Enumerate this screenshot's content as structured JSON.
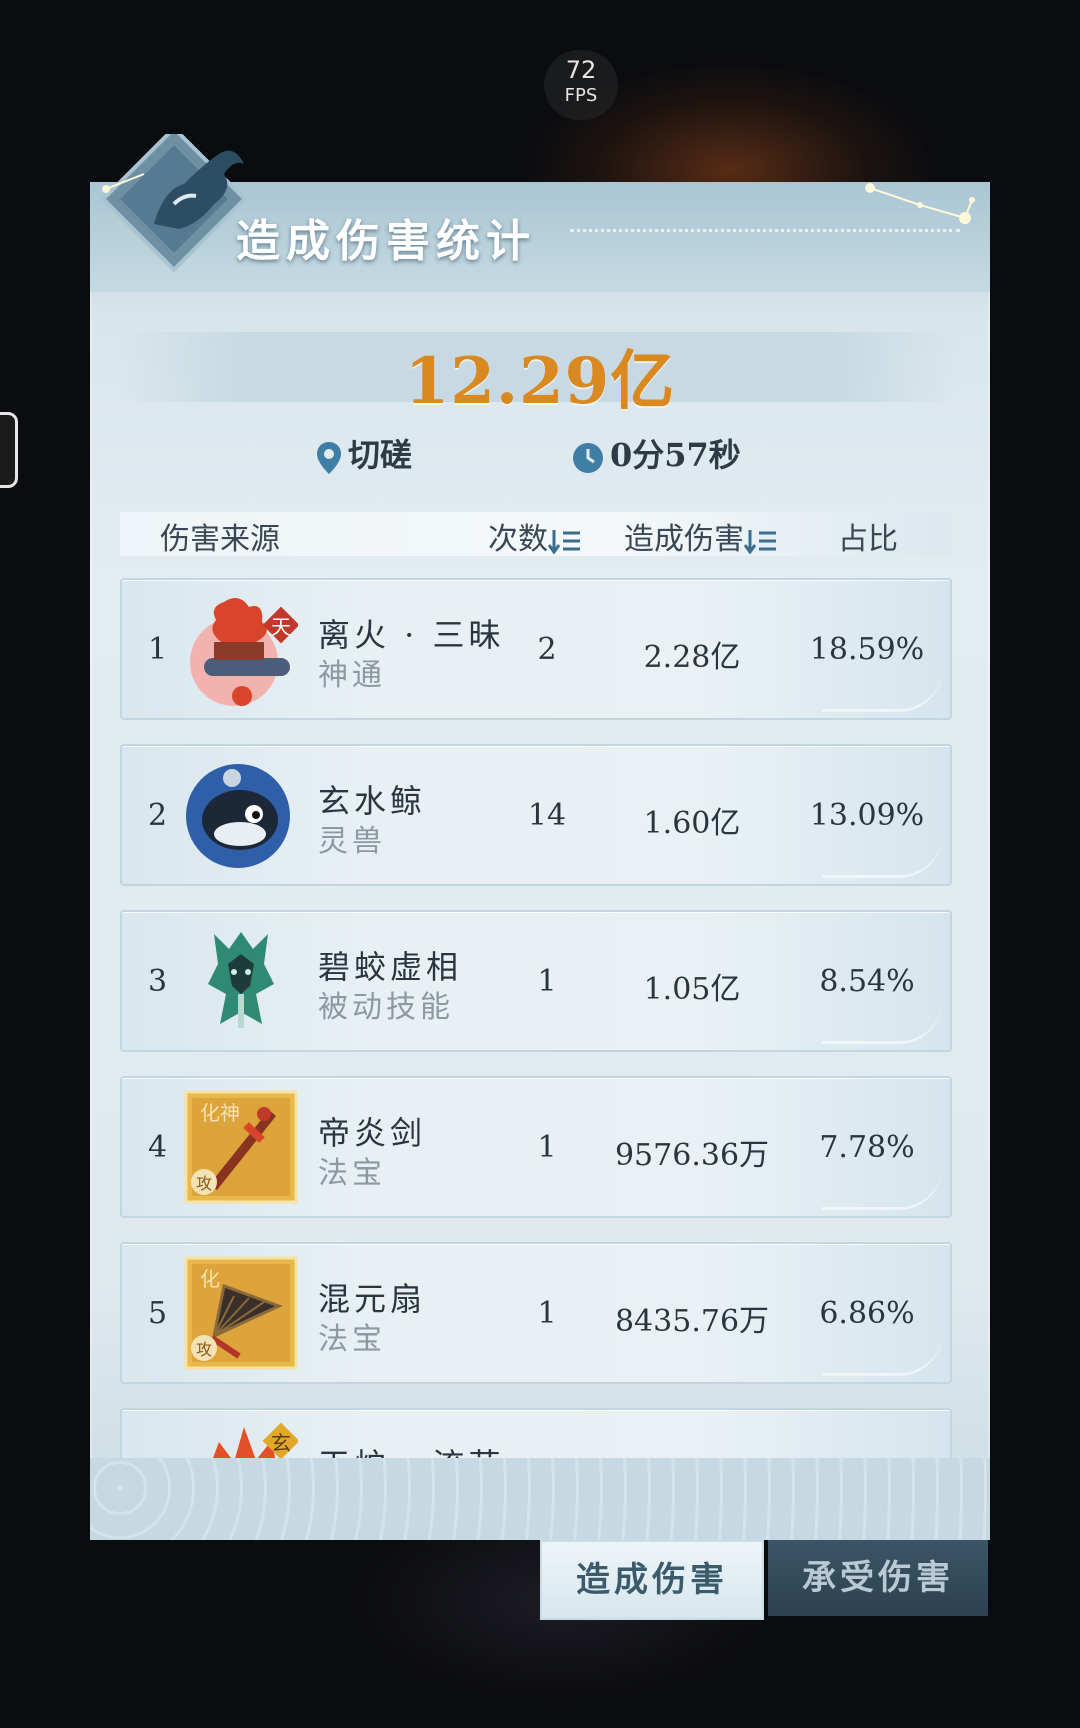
{
  "fps": {
    "value": "72",
    "unit": "FPS"
  },
  "panel": {
    "title": "造成伤害统计"
  },
  "summary": {
    "total_damage": "12.29亿",
    "location": "切磋",
    "duration": "0分57秒"
  },
  "table": {
    "headers": {
      "source": "伤害来源",
      "count": "次数",
      "damage": "造成伤害",
      "ratio": "占比"
    },
    "rows": [
      {
        "rank": "1",
        "name": "离火 · 三昧",
        "category": "神通",
        "count": "2",
        "damage": "2.28亿",
        "ratio": "18.59%",
        "badge": "天",
        "icon": "fire-scroll-icon"
      },
      {
        "rank": "2",
        "name": "玄水鲸",
        "category": "灵兽",
        "count": "14",
        "damage": "1.60亿",
        "ratio": "13.09%",
        "badge": "",
        "icon": "whale-icon"
      },
      {
        "rank": "3",
        "name": "碧蛟虚相",
        "category": "被动技能",
        "count": "1",
        "damage": "1.05亿",
        "ratio": "8.54%",
        "badge": "",
        "icon": "jade-dragon-icon"
      },
      {
        "rank": "4",
        "name": "帝炎剑",
        "category": "法宝",
        "count": "1",
        "damage": "9576.36万",
        "ratio": "7.78%",
        "badge": "化神",
        "tag": "攻",
        "icon": "sword-icon"
      },
      {
        "rank": "5",
        "name": "混元扇",
        "category": "法宝",
        "count": "1",
        "damage": "8435.76万",
        "ratio": "6.86%",
        "badge": "化",
        "tag": "攻",
        "icon": "fan-icon"
      },
      {
        "rank": "",
        "name": "天炉 · 流荧",
        "category": "",
        "count": "",
        "damage": "",
        "ratio": "",
        "badge": "玄",
        "icon": "furnace-icon"
      }
    ]
  },
  "tabs": [
    {
      "label": "造成伤害",
      "active": true
    },
    {
      "label": "承受伤害",
      "active": false
    }
  ],
  "colors": {
    "total": "#d9891f",
    "accent": "#3b6d8c"
  }
}
